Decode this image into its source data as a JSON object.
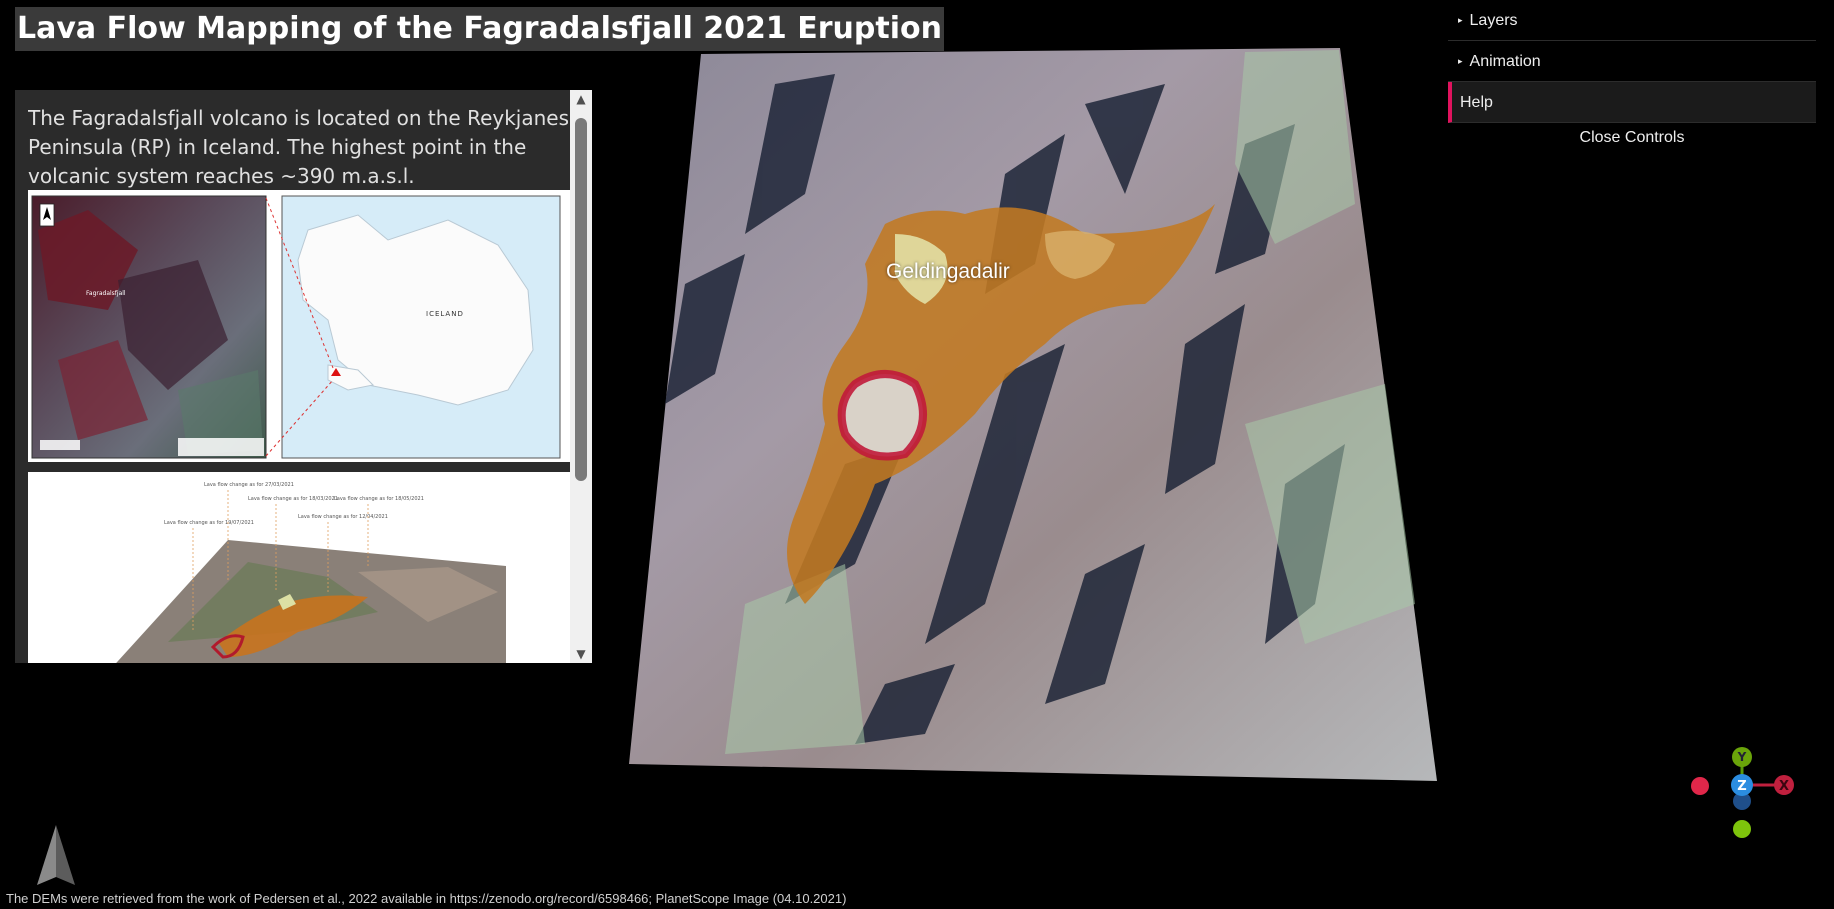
{
  "page": {
    "title": "Lava Flow Mapping of the Fagradalsfjall 2021 Eruption"
  },
  "info_panel": {
    "text": "The Fagradalsfjall volcano is located on the Reykjanes Peninsula (RP) in Iceland. The highest point in the volcanic system reaches ~390 m.a.s.l.",
    "location_map": {
      "country_label": "ICELAND",
      "volcano_label": "Fagradalsfjall"
    },
    "lava_figure": {
      "annotations": [
        "Lava flow change as for 27/03/2021",
        "Lava flow change as for 18/03/2021",
        "Lava flow change as for 18/05/2021",
        "Lava flow change as for 12/04/2021",
        "Lava flow change as for 19/07/2021"
      ]
    },
    "scroll_up_symbol": "▲",
    "scroll_down_symbol": "▼"
  },
  "map": {
    "place_label": "Geldingadalir"
  },
  "controls": {
    "items": [
      {
        "label": "Layers",
        "expander": "▸"
      },
      {
        "label": "Animation",
        "expander": "▸"
      },
      {
        "label": "Help"
      }
    ],
    "close_label": "Close Controls",
    "accent_color": "#e0135e"
  },
  "axis_gizmo": {
    "y_label": "Y",
    "z_label": "Z",
    "x_label": "X",
    "colors": {
      "x": "#e0274a",
      "y": "#7ec40c",
      "z": "#2b8de0"
    }
  },
  "footer": {
    "credit": "The DEMs were retrieved from the work of Pedersen et al., 2022 available in https://zenodo.org/record/6598466; PlanetScope Image (04.10.2021)"
  }
}
